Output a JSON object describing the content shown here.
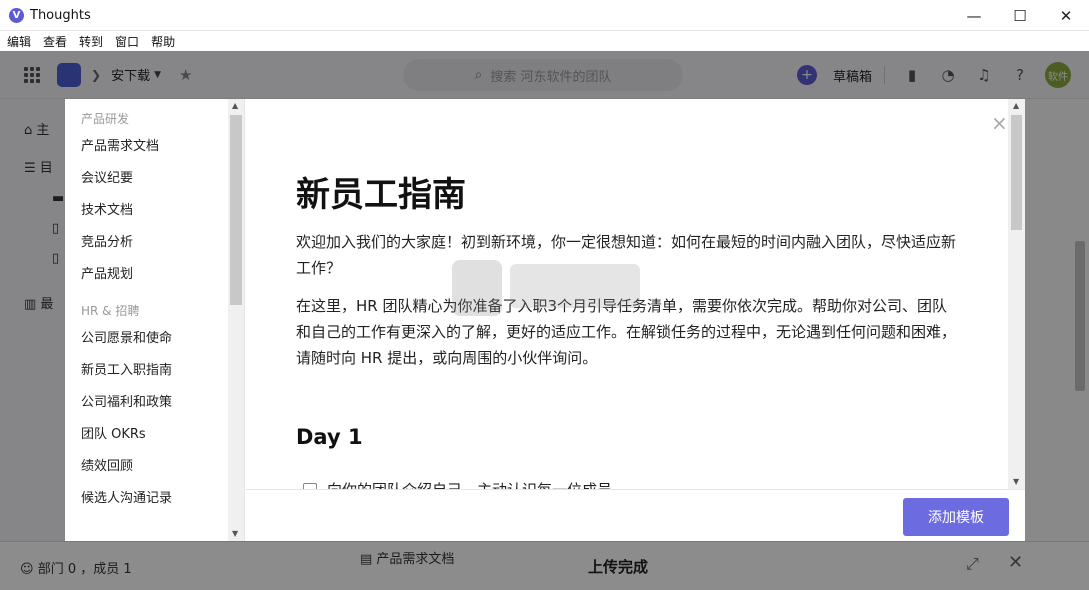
{
  "window": {
    "title": "Thoughts",
    "minimize": "—",
    "maximize": "☐",
    "close": "✕"
  },
  "menubar": [
    "编辑",
    "查看",
    "转到",
    "窗口",
    "帮助"
  ],
  "toolbar": {
    "team_name": "安下载",
    "search_placeholder": "搜索 河东软件的团队",
    "drafts_label": "草稿箱",
    "avatar_text": "软件"
  },
  "background": {
    "sidebar_items": [
      "主",
      "目",
      "最"
    ],
    "member_info": "部门 0 ，成员 1",
    "doc_label": "产品需求文档",
    "upload_status": "上传完成"
  },
  "modal": {
    "sidebar": [
      {
        "group": "产品研发",
        "items": [
          "产品需求文档",
          "会议纪要",
          "技术文档",
          "竞品分析",
          "产品规划"
        ]
      },
      {
        "group": "HR & 招聘",
        "items": [
          "公司愿景和使命",
          "新员工入职指南",
          "公司福利和政策",
          "团队 OKRs",
          "绩效回顾",
          "候选人沟通记录"
        ]
      }
    ],
    "title": "新员工指南",
    "para1": "欢迎加入我们的大家庭！初到新环境，你一定很想知道：如何在最短的时间内融入团队，尽快适应新工作？",
    "para2": "在这里，HR 团队精心为你准备了入职3个月引导任务清单，需要你依次完成。帮助你对公司、团队和自己的工作有更深入的了解，更好的适应工作。在解锁任务的过程中，无论遇到任何问题和困难，请随时向 HR 提出，或向周围的小伙伴询问。",
    "day_heading": "Day 1",
    "first_task": "向你的团队介绍自己，主动认识每一位成员",
    "add_button": "添加模板",
    "close_glyph": "×"
  },
  "colors": {
    "accent": "#6c6ce0",
    "overlay": "rgba(0,0,0,0.45)"
  }
}
